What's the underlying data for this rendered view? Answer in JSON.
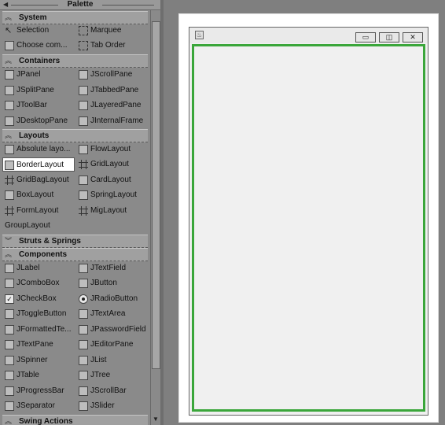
{
  "palette": {
    "title": "Palette",
    "categories": {
      "system": "System",
      "containers": "Containers",
      "layouts": "Layouts",
      "struts": "Struts & Springs",
      "components": "Components",
      "swing_actions": "Swing Actions"
    },
    "items": {
      "selection": "Selection",
      "marquee": "Marquee",
      "choose_component": "Choose com...",
      "tab_order": "Tab Order",
      "jpanel": "JPanel",
      "jscrollpane": "JScrollPane",
      "jsplitpane": "JSplitPane",
      "jtabbedpane": "JTabbedPane",
      "jtoolbar": "JToolBar",
      "jlayeredpane": "JLayeredPane",
      "jdesktoppane": "JDesktopPane",
      "jinternalframe": "JInternalFrame",
      "absolute_layout": "Absolute layo...",
      "flowlayout": "FlowLayout",
      "borderlayout": "BorderLayout",
      "gridlayout": "GridLayout",
      "gridbaglayout": "GridBagLayout",
      "cardlayout": "CardLayout",
      "boxlayout": "BoxLayout",
      "springlayout": "SpringLayout",
      "formlayout": "FormLayout",
      "miglayout": "MigLayout",
      "grouplayout": "GroupLayout",
      "jlabel": "JLabel",
      "jtextfield": "JTextField",
      "jcombobox": "JComboBox",
      "jbutton": "JButton",
      "jcheckbox": "JCheckBox",
      "jradiobutton": "JRadioButton",
      "jtogglebutton": "JToggleButton",
      "jtextarea": "JTextArea",
      "jformattedtextfield": "JFormattedTe...",
      "jpasswordfield": "JPasswordField",
      "jtextpane": "JTextPane",
      "jeditorpane": "JEditorPane",
      "jspinner": "JSpinner",
      "jlist": "JList",
      "jtable": "JTable",
      "jtree": "JTree",
      "jprogressbar": "JProgressBar",
      "jscrollbar": "JScrollBar",
      "jseparator": "JSeparator",
      "jslider": "JSlider"
    },
    "selected_item": "BorderLayout"
  },
  "colors": {
    "accent_border": "#3aa63a",
    "palette_bg": "#8a8a8a",
    "designer_bg": "#7f7f7f"
  }
}
